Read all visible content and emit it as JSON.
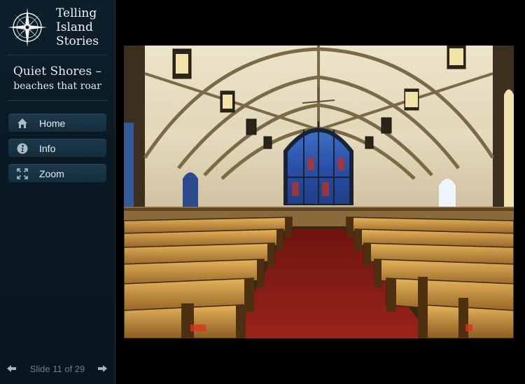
{
  "brand": {
    "line1": "Telling",
    "line2": "Island",
    "line3": "Stories"
  },
  "gallery": {
    "title": "Quiet Shores –",
    "subtitle": "beaches that roar"
  },
  "nav": [
    {
      "label": "Home",
      "icon": "home-icon"
    },
    {
      "label": "Info",
      "icon": "info-icon"
    },
    {
      "label": "Zoom",
      "icon": "zoom-icon"
    }
  ],
  "slide": {
    "counter": "Slide 11 of 29",
    "current": 11,
    "total": 29
  },
  "colors": {
    "sidebar": "#0a1a24",
    "button": "#1a384b",
    "text": "#e8eef2",
    "muted": "#6e7f89",
    "carpet": "#8a1a14",
    "wood": "#c9923e"
  }
}
